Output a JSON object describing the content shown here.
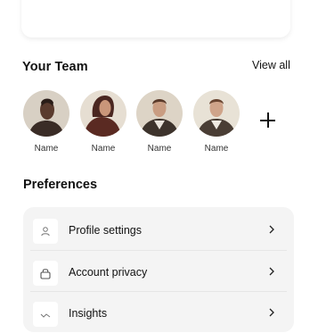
{
  "team": {
    "title": "Your Team",
    "view_all": "View all",
    "members": [
      {
        "name": "Name",
        "avatar": "person-avatar-1"
      },
      {
        "name": "Name",
        "avatar": "person-avatar-2"
      },
      {
        "name": "Name",
        "avatar": "person-avatar-3"
      },
      {
        "name": "Name",
        "avatar": "person-avatar-4"
      }
    ],
    "add_icon": "plus-icon"
  },
  "preferences": {
    "title": "Preferences",
    "items": [
      {
        "label": "Profile settings",
        "icon": "user-icon"
      },
      {
        "label": "Account privacy",
        "icon": "lock-icon"
      },
      {
        "label": "Insights",
        "icon": "chart-icon"
      }
    ]
  },
  "colors": {
    "background": "#ffffff",
    "card": "#f4f4f4",
    "text": "#111111"
  }
}
